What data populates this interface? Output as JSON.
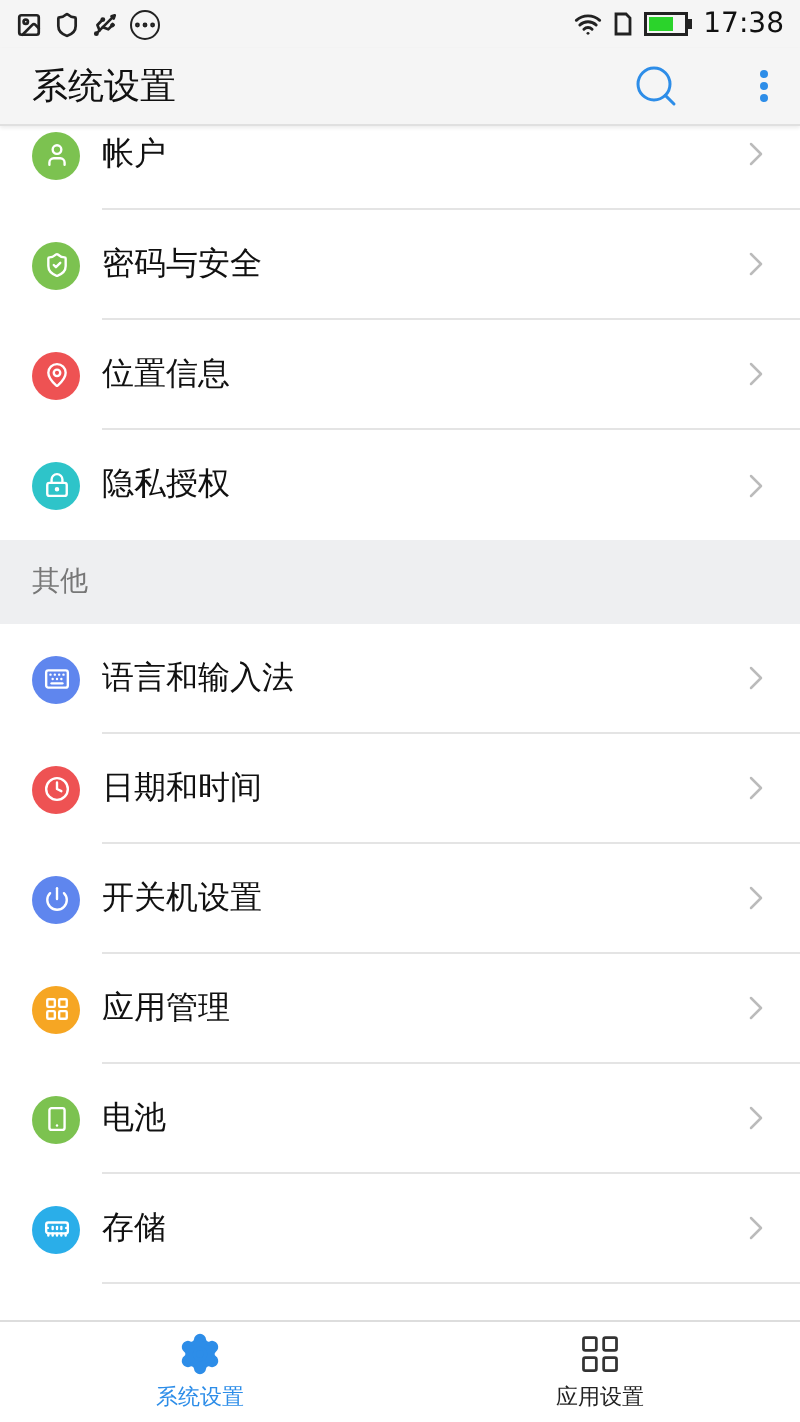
{
  "status_bar": {
    "time": "17:38"
  },
  "app_bar": {
    "title": "系统设置"
  },
  "groups": [
    {
      "items": [
        {
          "label": "帐户",
          "color": "#7cc250"
        },
        {
          "label": "密码与安全",
          "color": "#7cc250"
        },
        {
          "label": "位置信息",
          "color": "#ee5253"
        },
        {
          "label": "隐私授权",
          "color": "#2ec4c9"
        }
      ]
    },
    {
      "header": "其他",
      "items": [
        {
          "label": "语言和输入法",
          "color": "#5f86ee"
        },
        {
          "label": "日期和时间",
          "color": "#ee5253"
        },
        {
          "label": "开关机设置",
          "color": "#5f86ee"
        },
        {
          "label": "应用管理",
          "color": "#f6a623"
        },
        {
          "label": "电池",
          "color": "#7cc250"
        },
        {
          "label": "存储",
          "color": "#2aaee9"
        }
      ]
    }
  ],
  "bottom_nav": [
    {
      "label": "系统设置",
      "selected": true
    },
    {
      "label": "应用设置",
      "selected": false
    }
  ]
}
